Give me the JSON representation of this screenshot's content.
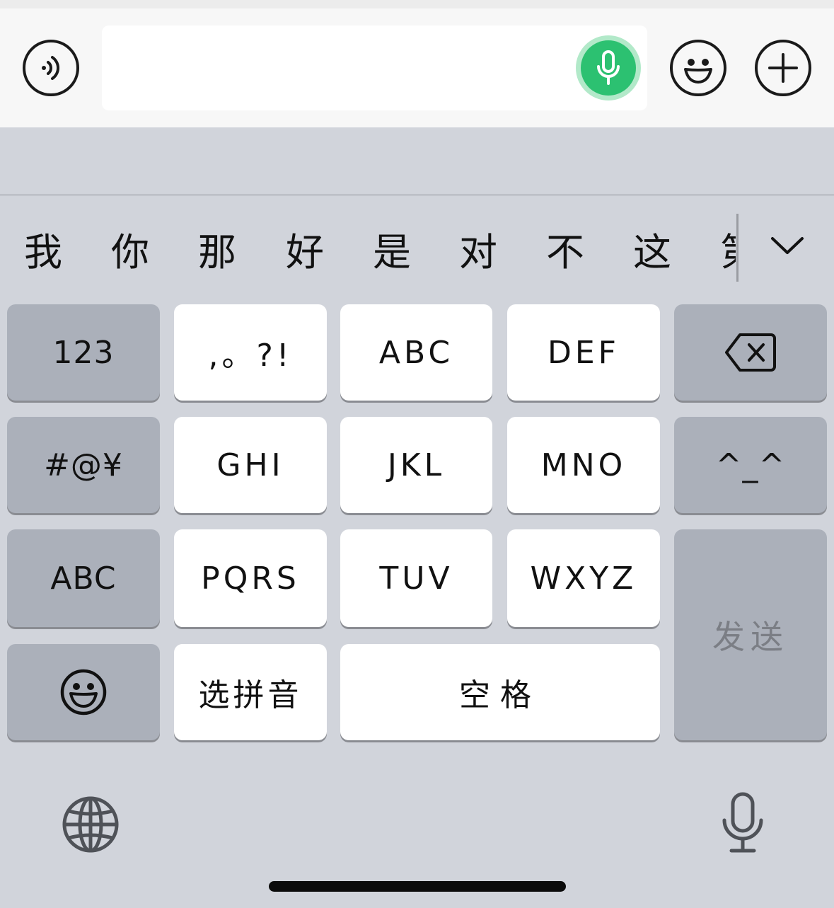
{
  "input_bar": {
    "voice_toggle_icon": "voice-wave-icon",
    "text_field_placeholder": "",
    "mic_icon": "microphone-icon",
    "emoji_icon": "emoji-icon",
    "plus_icon": "plus-icon"
  },
  "candidates": [
    "我",
    "你",
    "那",
    "好",
    "是",
    "对",
    "不",
    "这",
    "第"
  ],
  "keys": {
    "num": "123",
    "punct": ",。?!",
    "abc": "ABC",
    "def": "DEF",
    "symbols": "#@¥",
    "ghi": "GHI",
    "jkl": "JKL",
    "mno": "MNO",
    "kaomoji": "^_^",
    "abc_switch": "ABC",
    "pqrs": "PQRS",
    "tuv": "TUV",
    "wxyz": "WXYZ",
    "send": "发送",
    "pinyin": "选拼音",
    "space": "空格"
  },
  "colors": {
    "accent_green": "#2cc171",
    "keyboard_bg": "#d1d4db",
    "dark_key": "#abb0ba",
    "light_key": "#ffffff"
  }
}
